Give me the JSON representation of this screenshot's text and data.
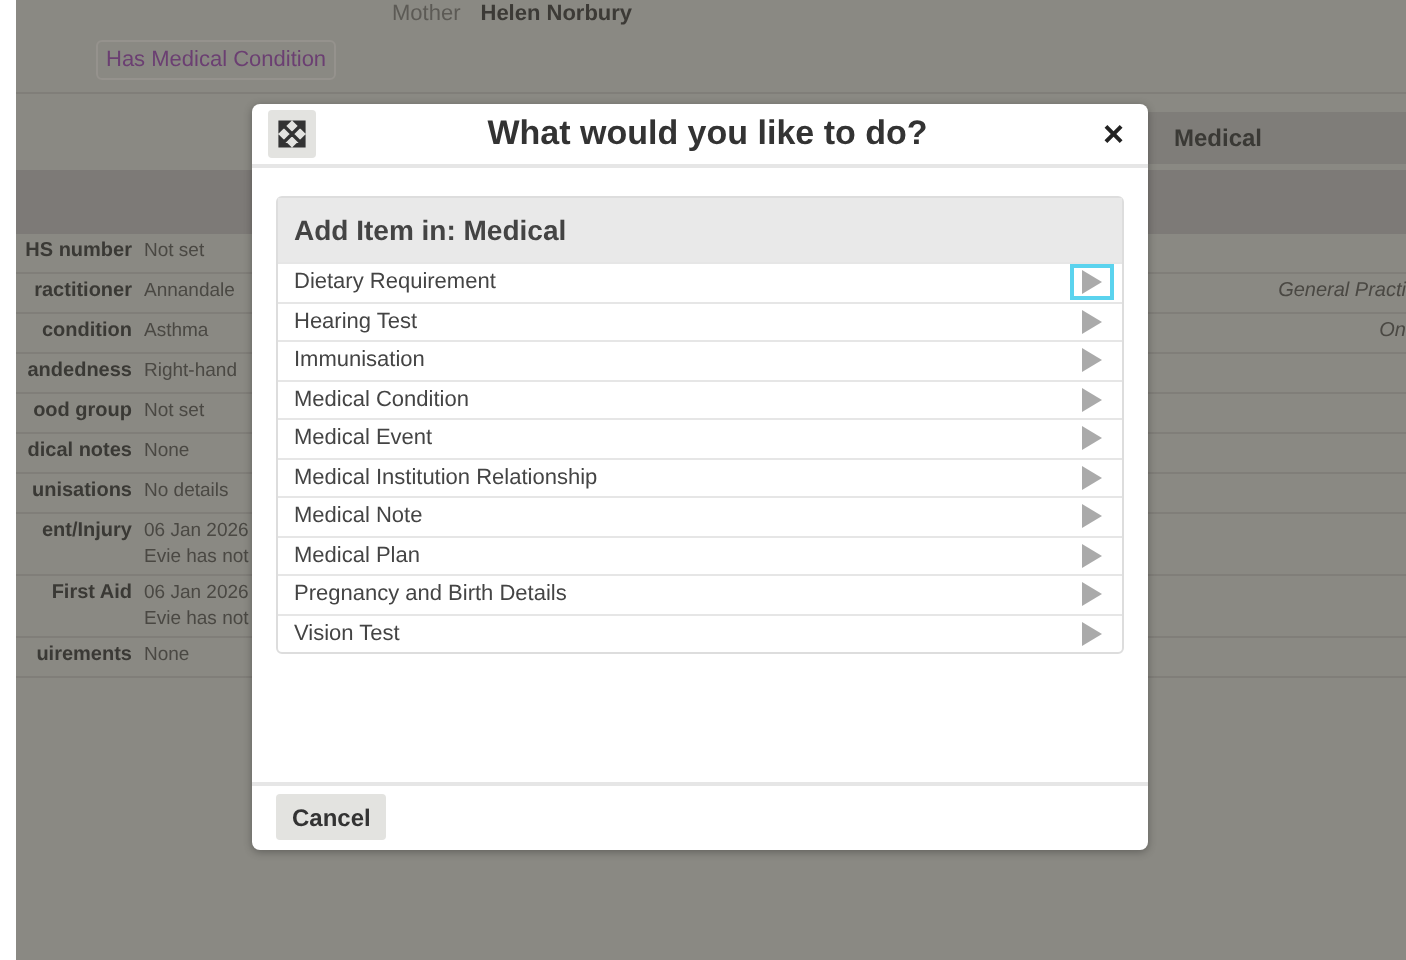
{
  "background": {
    "parent": {
      "label": "Mother",
      "name": "Helen Norbury"
    },
    "badge": "Has Medical Condition",
    "tab": {
      "label": "Medical",
      "selected": true
    },
    "rows": [
      {
        "label": "HS number",
        "values": [
          "Not set"
        ],
        "note": ""
      },
      {
        "label": "ractitioner",
        "values": [
          "Annandale"
        ],
        "note": "General Practi"
      },
      {
        "label": "condition",
        "values": [
          "Asthma"
        ],
        "note": "On"
      },
      {
        "label": "andedness",
        "values": [
          "Right-hand"
        ],
        "note": ""
      },
      {
        "label": "ood group",
        "values": [
          "Not set"
        ],
        "note": ""
      },
      {
        "label": "dical notes",
        "values": [
          "None"
        ],
        "note": ""
      },
      {
        "label": "unisations",
        "values": [
          "No details"
        ],
        "note": ""
      },
      {
        "label": "ent/Injury",
        "values": [
          "06 Jan 2026",
          "Evie has not"
        ],
        "note": ""
      },
      {
        "label": "First Aid",
        "values": [
          "06 Jan 2026",
          "Evie has not"
        ],
        "note": ""
      },
      {
        "label": "uirements",
        "values": [
          "None"
        ],
        "note": ""
      }
    ]
  },
  "dialog": {
    "title": "What would you like to do?",
    "close": "×",
    "panel_title": "Add Item in: Medical",
    "items": [
      {
        "label": "Dietary Requirement",
        "focused": true
      },
      {
        "label": "Hearing Test",
        "focused": false
      },
      {
        "label": "Immunisation",
        "focused": false
      },
      {
        "label": "Medical Condition",
        "focused": false
      },
      {
        "label": "Medical Event",
        "focused": false
      },
      {
        "label": "Medical Institution Relationship",
        "focused": false
      },
      {
        "label": "Medical Note",
        "focused": false
      },
      {
        "label": "Medical Plan",
        "focused": false
      },
      {
        "label": "Pregnancy and Birth Details",
        "focused": false
      },
      {
        "label": "Vision Test",
        "focused": false
      }
    ],
    "cancel": "Cancel"
  }
}
